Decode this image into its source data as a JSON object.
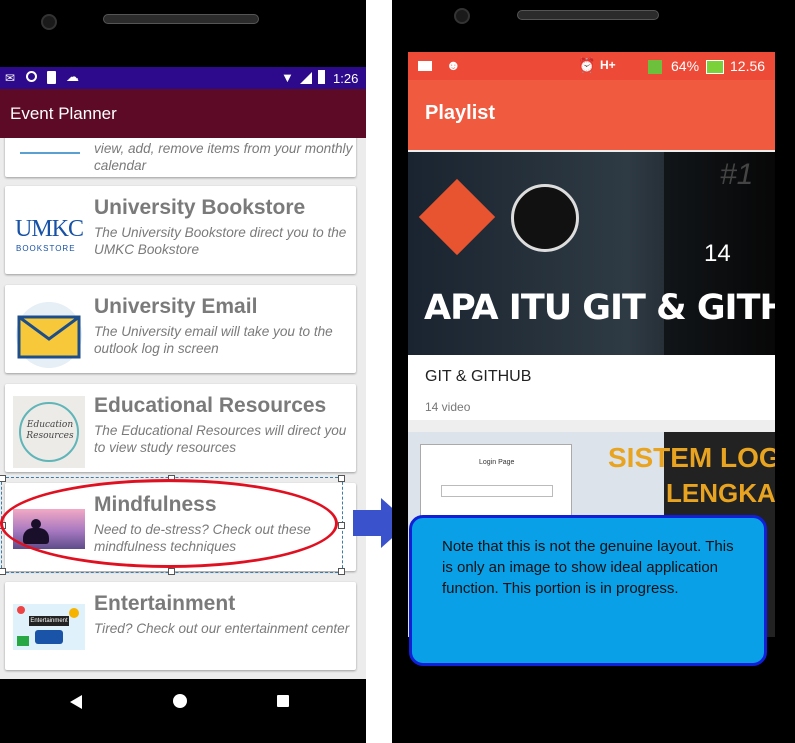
{
  "left": {
    "status_time": "1:26",
    "app_title": "Event Planner",
    "partial_card_desc": "view, add, remove items from your monthly calendar",
    "cards": [
      {
        "title": "University Bookstore",
        "desc": "The University Bookstore direct you to the UMKC Bookstore",
        "logo_main": "UMKC",
        "logo_sub": "BOOKSTORE"
      },
      {
        "title": "University Email",
        "desc": "The University email will take you to the outlook log in screen"
      },
      {
        "title": "Educational Resources",
        "desc": "The Educational Resources will direct you to view study resources",
        "logo_text": "Education Resources"
      },
      {
        "title": "Mindfulness",
        "desc": "Need to de-stress? Check out these mindfulness techniques"
      },
      {
        "title": "Entertainment",
        "desc": "Tired? Check out our entertainment center",
        "logo_text": "Entertainment"
      }
    ]
  },
  "right": {
    "status_battery": "64%",
    "status_time": "12.56",
    "app_title": "Playlist",
    "playlist1": {
      "banner": "APA ITU GIT & GITHUB ?",
      "count_overlay": "14",
      "badge": "#1",
      "title": "GIT & GITHUB",
      "count": "14 video"
    },
    "playlist2": {
      "banner_line1": "SISTEM LOGIN",
      "banner_line2": "LENGKAP",
      "login_label": "Login Page"
    }
  },
  "note": {
    "text": "Note that this is not the genuine layout. This is only an image to show ideal application function. This portion is in progress."
  },
  "colors": {
    "left_status": "#2d0a8b",
    "left_appbar": "#5c0a26",
    "right_appbar": "#f05a3e",
    "note_fill": "#0aa0e8",
    "note_border": "#1020d8",
    "highlight": "#e01020"
  }
}
